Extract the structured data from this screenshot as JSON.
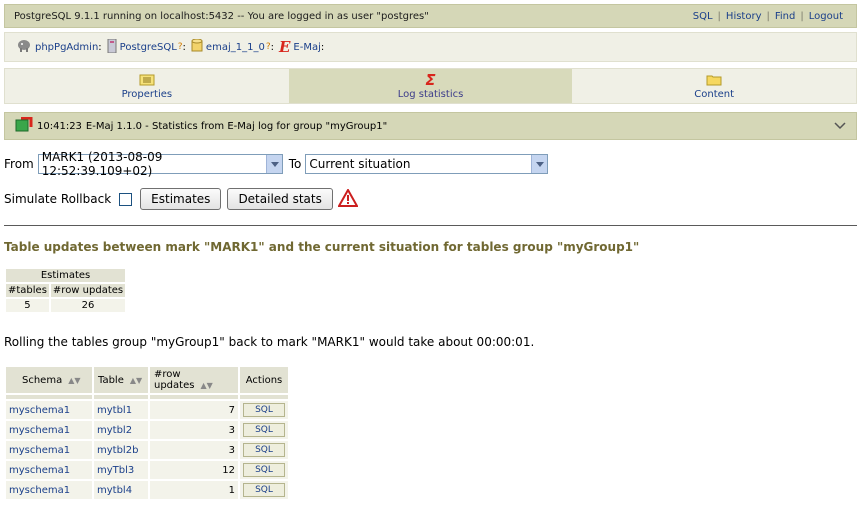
{
  "topbar": {
    "title": "PostgreSQL 9.1.1 running on localhost:5432 -- You are logged in as user \"postgres\"",
    "links": [
      "SQL",
      "History",
      "Find",
      "Logout"
    ]
  },
  "breadcrumb": {
    "app": "phpPgAdmin",
    "server": "PostgreSQL",
    "database": "emaj_1_1_0",
    "plugin": "E-Maj",
    "help_mark": "?",
    "separator": ":"
  },
  "tabs": [
    {
      "label": "Properties",
      "icon": "properties-icon",
      "active": false
    },
    {
      "label": "Log statistics",
      "icon": "sigma-icon",
      "active": true
    },
    {
      "label": "Content",
      "icon": "folder-icon",
      "active": false
    }
  ],
  "infobar": {
    "time": "10:41:23",
    "text": "E-Maj 1.1.0  -  Statistics from E-Maj log for group \"myGroup1\""
  },
  "form": {
    "from_label": "From",
    "from_value": "MARK1 (2013-08-09 12:52:39.109+02)",
    "to_label": "To",
    "to_value": "Current situation",
    "simulate_label": "Simulate Rollback",
    "estimates_button": "Estimates",
    "detailed_button": "Detailed stats"
  },
  "section_title": "Table updates between mark \"MARK1\" and the current situation for tables group \"myGroup1\"",
  "estimates": {
    "caption": "Estimates",
    "headers": [
      "#tables",
      "#row updates"
    ],
    "values": [
      "5",
      "26"
    ]
  },
  "rollback_message": "Rolling the tables group \"myGroup1\" back to mark \"MARK1\" would take about 00:00:01.",
  "stats": {
    "headers": [
      "Schema",
      "Table",
      "#row updates",
      "Actions"
    ],
    "action_label": "SQL",
    "rows": [
      {
        "schema": "myschema1",
        "table": "mytbl1",
        "updates": "7"
      },
      {
        "schema": "myschema1",
        "table": "mytbl2",
        "updates": "3"
      },
      {
        "schema": "myschema1",
        "table": "mytbl2b",
        "updates": "3"
      },
      {
        "schema": "myschema1",
        "table": "myTbl3",
        "updates": "12"
      },
      {
        "schema": "myschema1",
        "table": "mytbl4",
        "updates": "1"
      }
    ]
  }
}
